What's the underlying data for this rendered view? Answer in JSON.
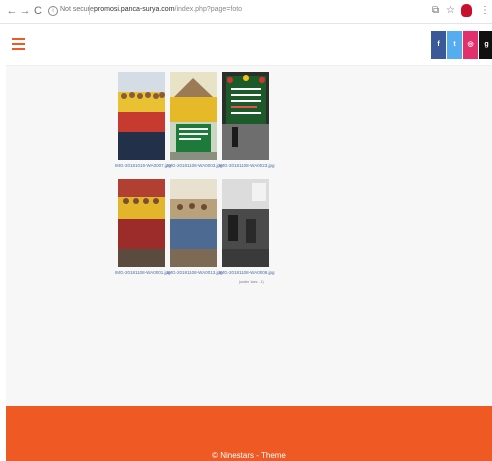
{
  "browser": {
    "back_glyph": "←",
    "forward_glyph": "→",
    "reload_glyph": "C",
    "info_glyph": "i",
    "security_label": "Not secure",
    "url_host": "promosi.panca-surya.com",
    "url_path": "/index.php?page=foto",
    "icons": [
      "back-icon",
      "forward-icon",
      "reload-icon",
      "info-icon",
      "extension-icon",
      "star-icon",
      "profile-icon",
      "menu-icon"
    ],
    "star_glyph": "☆",
    "ext_glyph": "⧉",
    "menu_glyph": "⋮"
  },
  "header": {
    "accent_color": "#ef5a24",
    "social": [
      {
        "glyph": "f",
        "color": "#3b5998",
        "icon": "facebook-icon"
      },
      {
        "glyph": "t",
        "color": "#55acee",
        "icon": "twitter-icon"
      },
      {
        "glyph": "◎",
        "color": "#e1306c",
        "icon": "instagram-icon"
      },
      {
        "glyph": "g",
        "color": "#111111",
        "icon": "google-plus-icon"
      }
    ]
  },
  "gallery": {
    "photos": [
      {
        "caption": "IMG-20181019-WA0007.jpg"
      },
      {
        "caption": "IMG-20181108-WA0003.jpg"
      },
      {
        "caption": "IMG-20181108-WA0023.jpg"
      },
      {
        "caption": "IMG-20181108-WA0001.jpg"
      },
      {
        "caption": "IMG-20181108-WA0013.jpg"
      },
      {
        "caption": "IMG-20181108-WA0008.jpg"
      }
    ],
    "page_info": "(under 1sec - 1)"
  },
  "footer": {
    "copyright": "© Ninestars - Theme",
    "color": "#ef5a24"
  }
}
